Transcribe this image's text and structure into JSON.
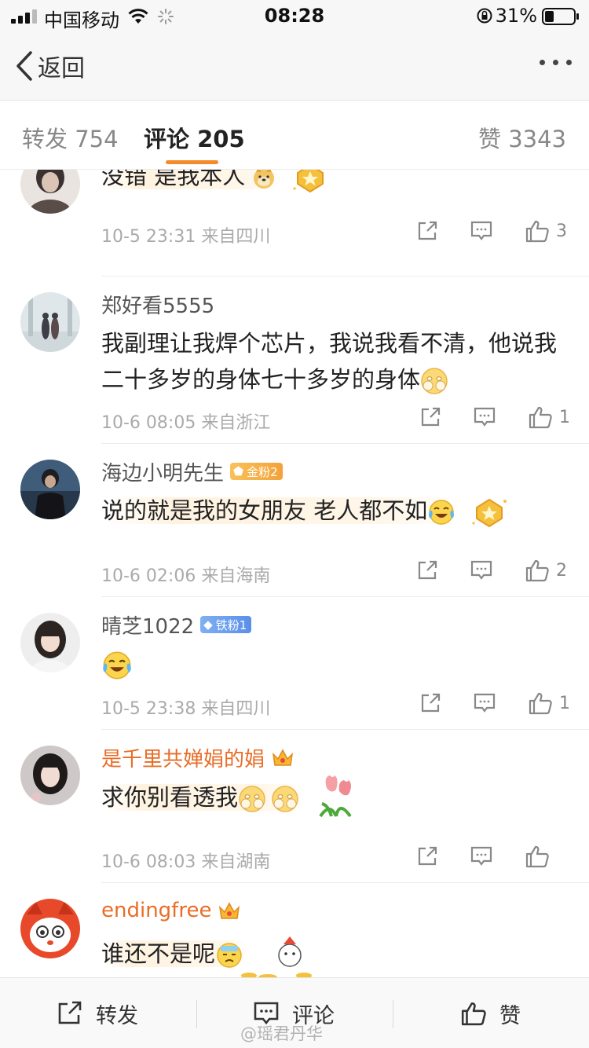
{
  "status_bar": {
    "carrier": "中国移动",
    "time": "08:28",
    "battery": "31%"
  },
  "nav": {
    "back_label": "返回"
  },
  "tabs": [
    {
      "label": "转发",
      "count": "754"
    },
    {
      "label": "评论",
      "count": "205"
    },
    {
      "label": "赞",
      "count": "3343"
    }
  ],
  "comments": [
    {
      "text": "没错 是我本人",
      "time": "10-5 23:31",
      "location": "来自四川",
      "likes": "3"
    },
    {
      "name": "郑好看5555",
      "text": "我副理让我焊个芯片，我说我看不清，他说我二十多岁的身体七十多岁的身体",
      "time": "10-6 08:05",
      "location": "来自浙江",
      "likes": "1"
    },
    {
      "name": "海边小明先生",
      "badge": "金粉2",
      "text": "说的就是我的女朋友 老人都不如",
      "time": "10-6 02:06",
      "location": "来自海南",
      "likes": "2"
    },
    {
      "name": "晴芝1022",
      "badge": "铁粉1",
      "text": "",
      "time": "10-5 23:38",
      "location": "来自四川",
      "likes": "1"
    },
    {
      "name": "是千里共婵娟的娟",
      "text": "求你别看透我",
      "time": "10-6 08:03",
      "location": "来自湖南",
      "likes": ""
    },
    {
      "name": "endingfree",
      "text": "谁还不是呢",
      "time": "",
      "location": "",
      "likes": ""
    }
  ],
  "bottom_bar": {
    "repost_label": "转发",
    "comment_label": "评论",
    "like_label": "赞"
  },
  "watermark": "@瑶君丹华",
  "colors": {
    "accent": "#f38b2a",
    "vip_name": "#e86d26",
    "meta_text": "#aaaaaa"
  },
  "icons": [
    "back-chevron-icon",
    "more-icon",
    "share-icon",
    "comment-icon",
    "like-icon",
    "doge-emoji",
    "hehe-emoji",
    "laugh-cry-emoji",
    "crown-icon",
    "medal-icon",
    "tulip-sticker"
  ]
}
